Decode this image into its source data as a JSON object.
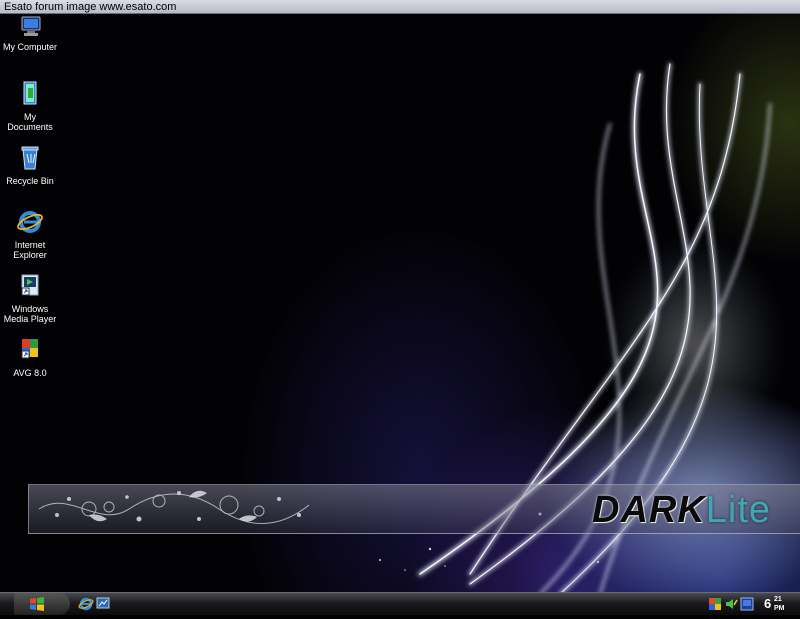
{
  "header": {
    "caption": "Esato forum image www.esato.com"
  },
  "desktop_icons": [
    {
      "label": "My Computer",
      "icon": "computer-icon"
    },
    {
      "label": "My Documents",
      "icon": "documents-folder-icon"
    },
    {
      "label": "Recycle Bin",
      "icon": "recycle-bin-icon"
    },
    {
      "label": "Internet Explorer",
      "icon": "internet-explorer-icon"
    },
    {
      "label": "Windows Media Player",
      "icon": "media-player-icon"
    },
    {
      "label": "AVG 8.0",
      "icon": "avg-antivirus-icon"
    }
  ],
  "brand": {
    "dark": "DARK",
    "lite": "Lite"
  },
  "taskbar": {
    "quick_launch": [
      "internet-explorer-icon",
      "show-desktop-icon"
    ],
    "tray": [
      "network-icon",
      "volume-icon",
      "security-icon"
    ],
    "clock": {
      "hour": "6",
      "minute": "21",
      "ampm": "PM"
    }
  },
  "colors": {
    "lite_text": "#3ea7b0",
    "taskbar": "#1b1b1f"
  }
}
